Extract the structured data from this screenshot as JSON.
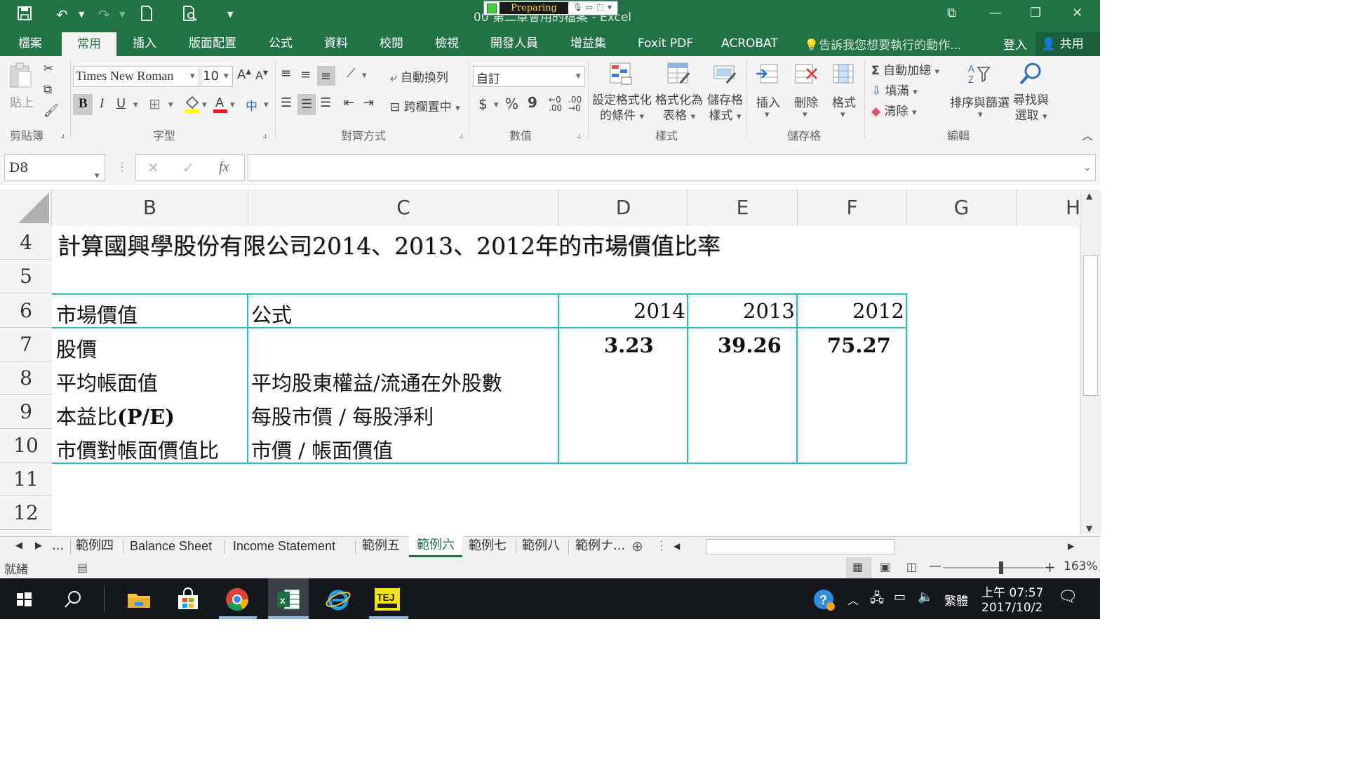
{
  "window": {
    "title": "00 第二章會用的檔案 - Excel",
    "preparing_label": "Preparing"
  },
  "ribbon_tabs": [
    "檔案",
    "常用",
    "插入",
    "版面配置",
    "公式",
    "資料",
    "校閱",
    "檢視",
    "開發人員",
    "增益集",
    "Foxit PDF",
    "ACROBAT"
  ],
  "active_tab": "常用",
  "tell_me": "告訴我您想要執行的動作...",
  "sign_in": "登入",
  "share": "共用",
  "ribbon": {
    "clipboard": {
      "paste": "貼上",
      "label": "剪貼簿"
    },
    "font": {
      "name": "Times New Roman",
      "size": "10",
      "bold": "B",
      "italic": "I",
      "underline": "U",
      "label": "字型"
    },
    "alignment": {
      "wrap": "自動換列",
      "merge": "跨欄置中",
      "label": "對齊方式"
    },
    "number": {
      "format": "自訂",
      "currency": "$",
      "percent": "%",
      "comma": "9",
      "label": "數值"
    },
    "styles": {
      "conditional_line1": "設定格式化",
      "conditional_line2": "的條件",
      "table_line1": "格式化為",
      "table_line2": "表格",
      "cell_line1": "儲存格",
      "cell_line2": "樣式",
      "label": "樣式"
    },
    "cells": {
      "insert": "插入",
      "delete": "刪除",
      "format": "格式",
      "label": "儲存格"
    },
    "editing": {
      "autosum": "自動加總",
      "fill": "填滿",
      "clear": "清除",
      "sort_filter": "排序與篩選",
      "find_line1": "尋找與",
      "find_line2": "選取",
      "label": "編輯"
    }
  },
  "formula_bar": {
    "name_box": "D8",
    "formula": ""
  },
  "columns": [
    "B",
    "C",
    "D",
    "E",
    "F",
    "G",
    "H"
  ],
  "rows": [
    "4",
    "5",
    "6",
    "7",
    "8",
    "9",
    "10",
    "11",
    "12"
  ],
  "sheet": {
    "title": "計算國興學股份有限公司2014、2013、2012年的市場價值比率",
    "header_row": {
      "label": "市場價值",
      "formula": "公式",
      "y2014": "2014",
      "y2013": "2013",
      "y2012": "2012"
    },
    "rows": [
      {
        "label": "股價",
        "formula": "",
        "y2014": "3.23",
        "y2013": "39.26",
        "y2012": "75.27"
      },
      {
        "label": "平均帳面值",
        "formula": "平均股東權益/流通在外股數"
      },
      {
        "label": "本益比(P/E)",
        "formula": "每股市價 / 每股淨利"
      },
      {
        "label": "市價對帳面價值比",
        "formula": "市價 / 帳面價值"
      }
    ]
  },
  "sheet_tabs": [
    "範例四",
    "Balance Sheet",
    "Income Statement",
    "範例五",
    "範例六",
    "範例七",
    "範例八",
    "範例ナ..."
  ],
  "active_sheet": "範例六",
  "sheet_nav_more": "...",
  "status": {
    "ready": "就緒",
    "zoom": "163%"
  },
  "taskbar": {
    "ime": "繁體",
    "time": "上午 07:57",
    "date": "2017/10/2"
  },
  "colors": {
    "excel_green": "#217346",
    "table_border": "#2fb8c8"
  }
}
